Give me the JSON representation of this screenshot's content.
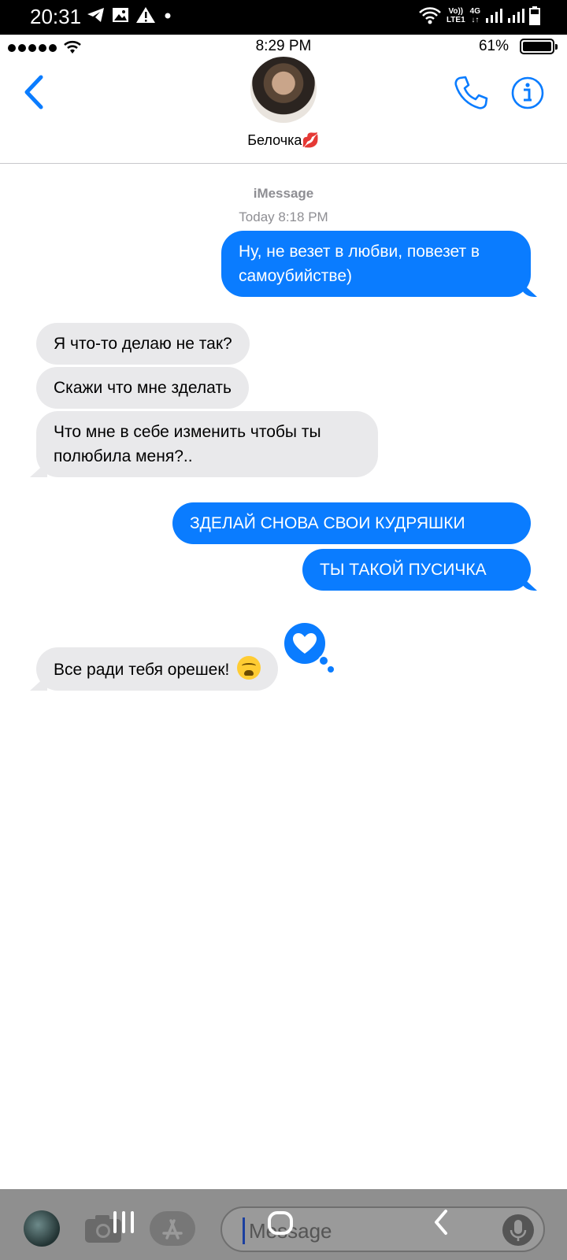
{
  "android_status": {
    "time": "20:31",
    "network_label_top": "Vo))",
    "network_label_bottom": "LTE1",
    "network_type": "4G"
  },
  "ios_status": {
    "time": "8:29 PM",
    "battery": "61%"
  },
  "header": {
    "contact_name": "Белочка💋"
  },
  "thread": {
    "service": "iMessage",
    "timestamp": "Today 8:18 PM",
    "messages": [
      {
        "from": "me",
        "text": "Ну, не везет в любви, повезет в самоубийстве)"
      },
      {
        "from": "them",
        "text": "Я что-то делаю не так?"
      },
      {
        "from": "them",
        "text": "Скажи что мне зделать"
      },
      {
        "from": "them",
        "text": "Что мне в себе изменить чтобы ты полюбила меня?.."
      },
      {
        "from": "me",
        "text": "ЗДЕЛАЙ СНОВА СВОИ КУДРЯШКИ"
      },
      {
        "from": "me",
        "text": "ТЫ ТАКОЙ ПУСИЧКА"
      },
      {
        "from": "them",
        "text": "Все ради тебя орешек!"
      }
    ]
  },
  "input": {
    "placeholder": "Message"
  },
  "colors": {
    "accent": "#0a7cff",
    "received_bubble": "#e9e9eb"
  },
  "icons": [
    "back-chevron-icon",
    "phone-icon",
    "info-icon",
    "heart-reaction-icon",
    "camera-icon",
    "app-store-icon",
    "mic-icon",
    "sob-emoji-icon"
  ]
}
